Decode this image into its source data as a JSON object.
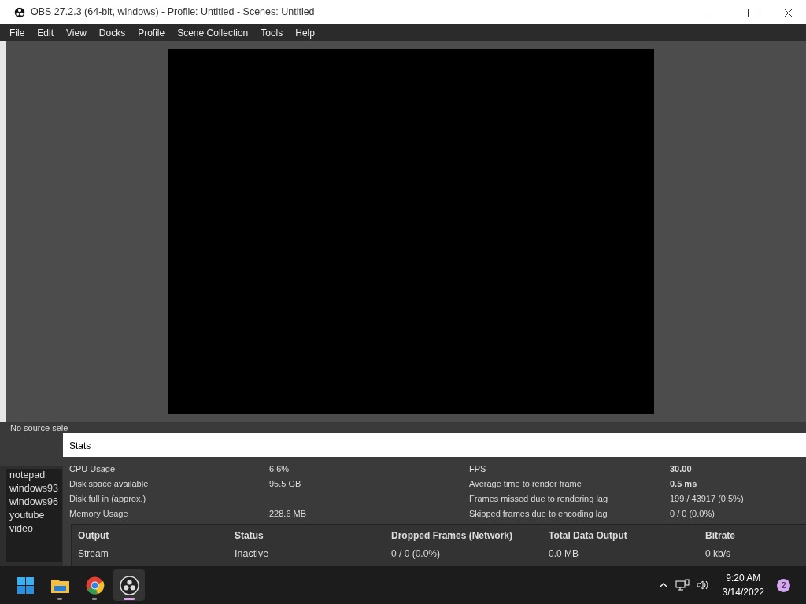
{
  "window": {
    "title": "OBS 27.2.3 (64-bit, windows) - Profile: Untitled - Scenes: Untitled"
  },
  "menu": [
    "File",
    "Edit",
    "View",
    "Docks",
    "Profile",
    "Scene Collection",
    "Tools",
    "Help"
  ],
  "source_bar": {
    "text": "No source sele"
  },
  "scenes": [
    {
      "name": "notepad"
    },
    {
      "name": "windows93"
    },
    {
      "name": "windows96"
    },
    {
      "name": "youtube"
    },
    {
      "name": "video"
    }
  ],
  "stats": {
    "title": "Stats",
    "left": [
      {
        "label": "CPU Usage",
        "value": "6.6%"
      },
      {
        "label": "Disk space available",
        "value": "95.5 GB"
      },
      {
        "label": "Disk full in (approx.)"
      },
      {
        "label": "Memory Usage",
        "value": "228.6 MB"
      }
    ],
    "right": [
      {
        "label": "FPS",
        "value": "30.00",
        "bold": true
      },
      {
        "label": "Average time to render frame",
        "value": "0.5 ms",
        "bold": true
      },
      {
        "label": "Frames missed due to rendering lag",
        "value": "199 / 43917 (0.5%)",
        "bold": false
      },
      {
        "label": "Skipped frames due to encoding lag",
        "value": "0 / 0 (0.0%)",
        "bold": false
      }
    ],
    "outputs": {
      "columns": [
        "Output",
        "Status",
        "Dropped Frames (Network)",
        "Total Data Output",
        "Bitrate"
      ],
      "rows": [
        [
          "Stream",
          "Inactive",
          "0 / 0 (0.0%)",
          "0.0 MB",
          "0 kb/s"
        ]
      ]
    }
  },
  "taskbar": {
    "apps": [
      {
        "kind": "start",
        "active": false
      },
      {
        "kind": "folder",
        "active": false
      },
      {
        "kind": "browser",
        "active": false
      },
      {
        "kind": "obs",
        "active": true
      }
    ],
    "time": "9:20 AM",
    "date": "3/14/2022",
    "notifications": "2"
  }
}
